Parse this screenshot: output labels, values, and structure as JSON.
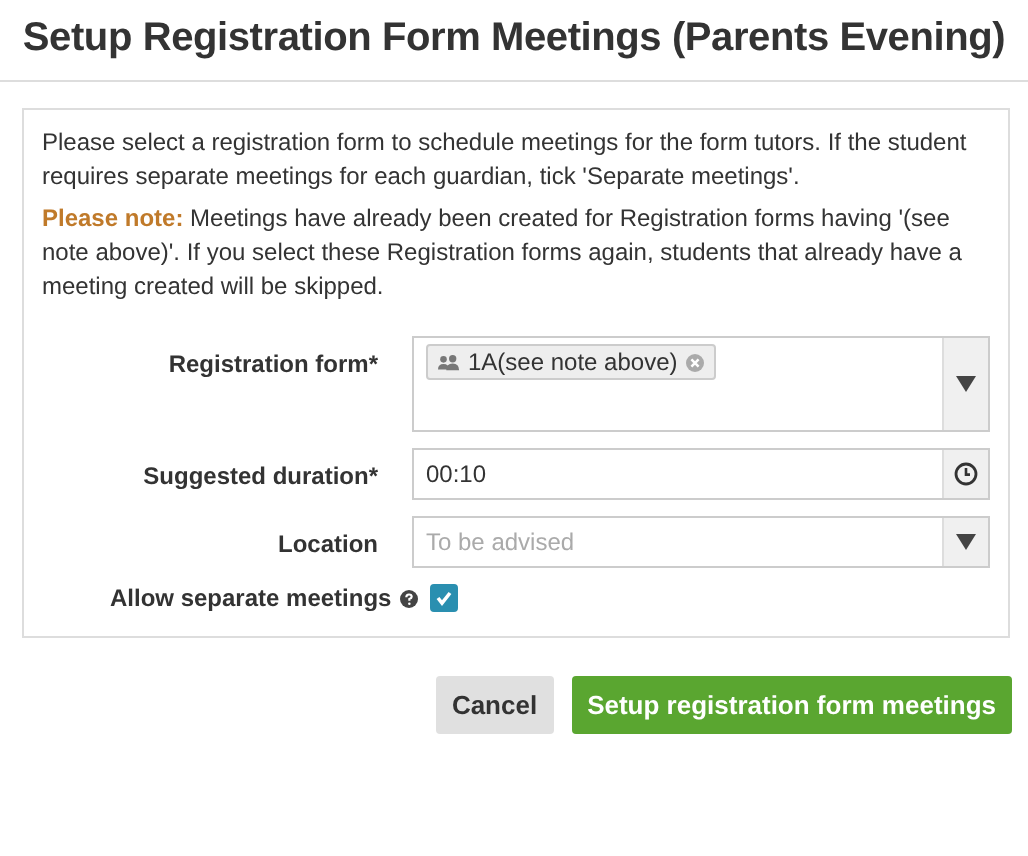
{
  "title": "Setup Registration Form Meetings (Parents Evening)",
  "intro": "Please select a registration form to schedule meetings for the form tutors. If the student requires separate meetings for each guardian, tick 'Separate meetings'.",
  "note": {
    "label": "Please note:",
    "text": "Meetings have already been created for Registration forms having '(see note above)'. If you select these Registration forms again, students that already have a meeting created will be skipped."
  },
  "fields": [
    {
      "kind": "tags",
      "label": "Registration form*",
      "tags": [
        "1A(see note above)"
      ]
    },
    {
      "kind": "time",
      "label": "Suggested duration*",
      "value": "00:10"
    },
    {
      "kind": "select",
      "label": "Location",
      "placeholder": "To be advised"
    },
    {
      "kind": "checkbox",
      "label": "Allow separate meetings",
      "checked": true
    }
  ],
  "buttons": [
    {
      "kind": "cancel",
      "label": "Cancel"
    },
    {
      "kind": "primary",
      "label": "Setup registration form meetings"
    }
  ]
}
